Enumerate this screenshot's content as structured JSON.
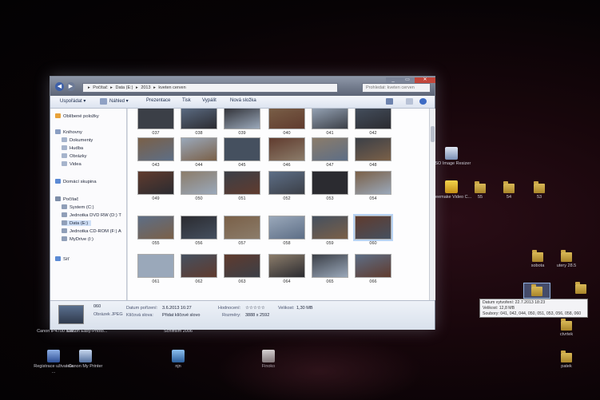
{
  "window": {
    "address_parts": [
      "▸",
      "Počítač",
      "▸",
      "Data (E:)",
      "▸",
      "2013",
      "▸",
      "kveten cerven"
    ],
    "search_placeholder": "Prohledat: kveten cerven",
    "controls": [
      "_",
      "▭",
      "✕"
    ]
  },
  "toolbar": {
    "items": [
      "Uspořádat ▾",
      "Náhled ▾",
      "Prezentace",
      "Tisk",
      "Vypálit",
      "Nová složka"
    ]
  },
  "sidebar": {
    "items": [
      {
        "label": "Oblíbené položky",
        "level": 0
      },
      {
        "label": "Knihovny",
        "level": 0
      },
      {
        "label": "Dokumenty",
        "level": 1
      },
      {
        "label": "Hudba",
        "level": 1
      },
      {
        "label": "Obrázky",
        "level": 1
      },
      {
        "label": "Videa",
        "level": 1
      },
      {
        "label": "Domácí skupina",
        "level": 0
      },
      {
        "label": "Počítač",
        "level": 0
      },
      {
        "label": "System (C:)",
        "level": 1
      },
      {
        "label": "Jednotka DVD RW (D:) T",
        "level": 1
      },
      {
        "label": "Data (E:)",
        "level": 1
      },
      {
        "label": "Jednotka CD-ROM (F:) A",
        "level": 1
      },
      {
        "label": "MyDrive (I:)",
        "level": 1
      },
      {
        "label": "Síť",
        "level": 0
      }
    ]
  },
  "thumbnails": {
    "rows": [
      [
        "037",
        "038",
        "039",
        "040",
        "041",
        "042"
      ],
      [
        "043",
        "044",
        "045",
        "046",
        "047",
        "048"
      ],
      [
        "049",
        "050",
        "051",
        "052",
        "053",
        "054"
      ],
      [
        "055",
        "056",
        "057",
        "058",
        "059",
        "060"
      ],
      [
        "061",
        "062",
        "063",
        "064",
        "065",
        "066"
      ]
    ]
  },
  "details": {
    "name": "060",
    "type": "Obrázek JPEG",
    "date_label": "Datum pořízení:",
    "date_value": "3.6.2013 16:27",
    "tags_label": "Klíčová slova:",
    "tags_value": "Přidat klíčové slovo",
    "rating_label": "Hodnocení:",
    "rating_value": "☆☆☆☆☆",
    "dims_label": "Rozměry:",
    "dims_value": "3888 x 2592",
    "size_label": "Velikost:",
    "size_value": "1,30 MB"
  },
  "desktop_icons": [
    {
      "label": "VSO Image Resizer"
    },
    {
      "label": "Freemake Video C..."
    },
    {
      "label": "55"
    },
    {
      "label": "54"
    },
    {
      "label": "53"
    },
    {
      "label": "sobota"
    },
    {
      "label": "utery 28.5"
    },
    {
      "label": "ctvrtek"
    },
    {
      "label": "patek"
    },
    {
      "label": "Canon iP4700 seri..."
    },
    {
      "label": "Canon Easy-Photo..."
    },
    {
      "label": "Schiffsim 2006"
    },
    {
      "label": "njn"
    },
    {
      "label": "Finoko"
    },
    {
      "label": "Registrace uživatele ..."
    },
    {
      "label": "Canon My Printer"
    }
  ],
  "tooltip": {
    "line1": "Datum vytvoření: 22.7.2013 18:23",
    "line2": "Velikost: 12,8 MB",
    "line3": "Soubory: 041, 042, 044, 050, 051, 053, 056, 058, 060"
  }
}
